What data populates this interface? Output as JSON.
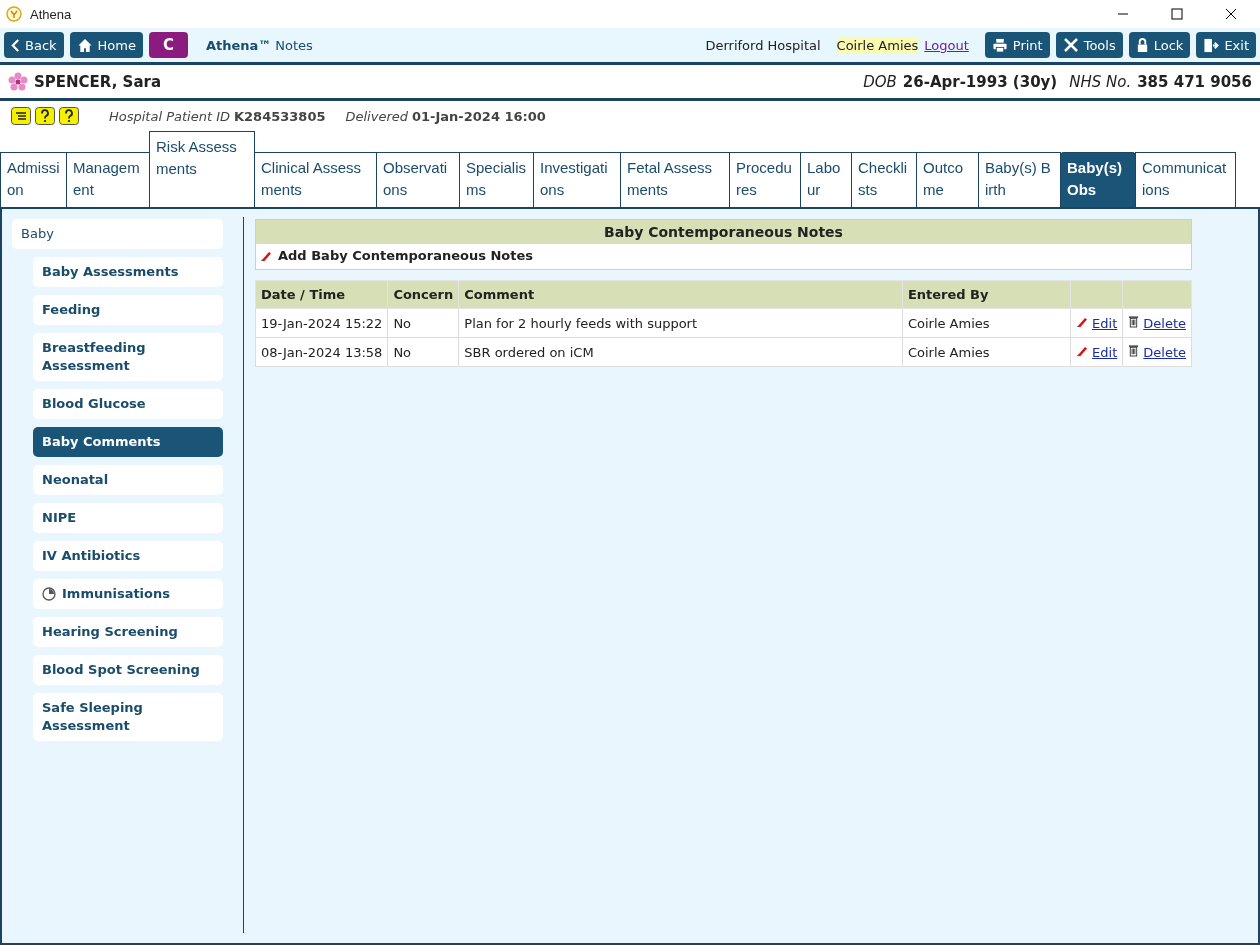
{
  "window": {
    "title": "Athena"
  },
  "toolbar": {
    "back": "Back",
    "home": "Home",
    "badge": "C",
    "brand": "Athena™",
    "module": "Notes",
    "hospital": "Derriford Hospital",
    "user": "Coirle Amies",
    "logout": "Logout",
    "actions": [
      "Print",
      "Tools",
      "Lock",
      "Exit"
    ]
  },
  "patient": {
    "name": "SPENCER, Sara",
    "dob_label": "DOB",
    "dob": "26-Apr-1993 (30y)",
    "nhs_label": "NHS No.",
    "nhs": "385 471 9056",
    "id_label": "Hospital Patient ID",
    "id": "K284533805",
    "delivered_label": "Delivered",
    "delivered": "01-Jan-2024 16:00"
  },
  "tabs": [
    {
      "label": "Admission",
      "selected": false,
      "raised": false
    },
    {
      "label": "Management",
      "selected": false,
      "raised": false
    },
    {
      "label": "Risk Assessments",
      "selected": false,
      "raised": true
    },
    {
      "label": "Clinical Assessments",
      "selected": false,
      "raised": false
    },
    {
      "label": "Observations",
      "selected": false,
      "raised": false
    },
    {
      "label": "Specialisms",
      "selected": false,
      "raised": false
    },
    {
      "label": "Investigations",
      "selected": false,
      "raised": false
    },
    {
      "label": "Fetal Assessments",
      "selected": false,
      "raised": false
    },
    {
      "label": "Procedures",
      "selected": false,
      "raised": false
    },
    {
      "label": "Labour",
      "selected": false,
      "raised": false
    },
    {
      "label": "Checklists",
      "selected": false,
      "raised": false
    },
    {
      "label": "Outcome",
      "selected": false,
      "raised": false
    },
    {
      "label": "Baby(s) Birth",
      "selected": false,
      "raised": false
    },
    {
      "label": "Baby(s) Obs",
      "selected": true,
      "raised": false
    },
    {
      "label": "Communications",
      "selected": false,
      "raised": false
    }
  ],
  "sidebar": {
    "items": [
      {
        "label": "Baby",
        "selected": false,
        "children": [
          {
            "label": "Baby Assessments",
            "selected": false,
            "kind": "plain"
          },
          {
            "label": "Feeding",
            "selected": false,
            "kind": "plain"
          },
          {
            "label": "Breastfeeding Assessment",
            "selected": false,
            "kind": "plain"
          },
          {
            "label": "Blood Glucose",
            "selected": false,
            "kind": "plain"
          },
          {
            "label": "Baby Comments",
            "selected": true,
            "kind": "plain"
          },
          {
            "label": "Neonatal",
            "selected": false,
            "kind": "plain"
          },
          {
            "label": "NIPE",
            "selected": false,
            "kind": "plain"
          },
          {
            "label": "IV Antibiotics",
            "selected": false,
            "kind": "plain"
          },
          {
            "label": "Immunisations",
            "selected": false,
            "kind": "timed"
          },
          {
            "label": "Hearing Screening",
            "selected": false,
            "kind": "plain"
          },
          {
            "label": "Blood Spot Screening",
            "selected": false,
            "kind": "plain"
          },
          {
            "label": "Safe Sleeping Assessment",
            "selected": false,
            "kind": "plain"
          }
        ]
      }
    ]
  },
  "panel": {
    "title": "Baby Contemporaneous Notes",
    "add": "Add Baby Contemporaneous Notes"
  },
  "table": {
    "columns": [
      "Date / Time",
      "Concern",
      "Comment",
      "Entered By"
    ],
    "rows": [
      {
        "date": "19-Jan-2024 15:22",
        "concern": "No",
        "comment": "Plan for 2 hourly feeds with support",
        "entered_by": "Coirle Amies",
        "edit": "Edit",
        "delete": "Delete"
      },
      {
        "date": "08-Jan-2024 13:58",
        "concern": "No",
        "comment": "SBR ordered on iCM",
        "entered_by": "Coirle Amies",
        "edit": "Edit",
        "delete": "Delete"
      }
    ]
  }
}
